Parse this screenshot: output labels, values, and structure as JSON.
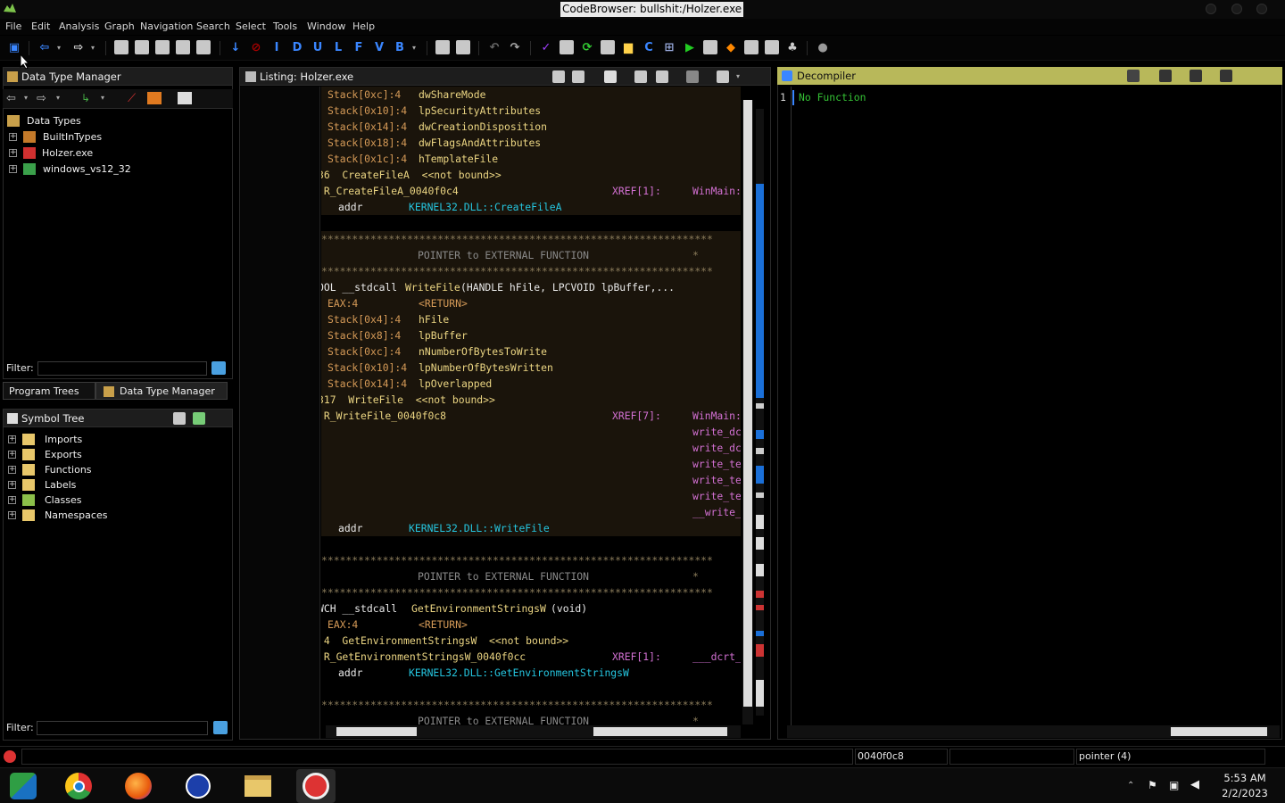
{
  "window": {
    "title": "CodeBrowser: bullshit:/Holzer.exe"
  },
  "menu": [
    "File",
    "Edit",
    "Analysis",
    "Graph",
    "Navigation",
    "Search",
    "Select",
    "Tools",
    "Window",
    "Help"
  ],
  "toolbar": {
    "letters": [
      "I",
      "D",
      "U",
      "L",
      "F",
      "V",
      "B"
    ]
  },
  "data_type_manager": {
    "title": "Data Type Manager",
    "root": "Data Types",
    "items": [
      "BuiltInTypes",
      "Holzer.exe",
      "windows_vs12_32"
    ],
    "filter_label": "Filter:"
  },
  "left_tabs": {
    "program_trees": "Program Trees",
    "data_type_manager": "Data Type Manager"
  },
  "symbol_tree": {
    "title": "Symbol Tree",
    "items": [
      "Imports",
      "Exports",
      "Functions",
      "Labels",
      "Classes",
      "Namespaces"
    ],
    "filter_label": "Filter:"
  },
  "listing": {
    "title": "Listing:  Holzer.exe",
    "lines": [
      {
        "a": "Stack[0xc]:4",
        "b": "dwShareMode"
      },
      {
        "a": "Stack[0x10]:4",
        "b": "lpSecurityAttributes"
      },
      {
        "a": "Stack[0x14]:4",
        "b": "dwCreationDisposition"
      },
      {
        "a": "Stack[0x18]:4",
        "b": "dwFlagsAndAttributes"
      },
      {
        "a": "Stack[0x1c]:4",
        "b": "hTemplateFile"
      },
      {
        "a": "36  CreateFileA  <<not bound>>"
      },
      {
        "a": "'R_CreateFileA_0040f0c4",
        "x": "XREF[1]:",
        "r": "WinMain:"
      },
      {
        "a": "addr",
        "b": "KERNEL32.DLL::CreateFileA"
      },
      {
        "a": "****************************************************************"
      },
      {
        "a": "POINTER to EXTERNAL FUNCTION",
        "b": "*"
      },
      {
        "a": "****************************************************************"
      },
      {
        "a": "OOL __stdcall",
        "b": "WriteFile",
        "c": "(HANDLE hFile, LPCVOID lpBuffer,..."
      },
      {
        "a": "EAX:4",
        "b": "<RETURN>"
      },
      {
        "a": "Stack[0x4]:4",
        "b": "hFile"
      },
      {
        "a": "Stack[0x8]:4",
        "b": "lpBuffer"
      },
      {
        "a": "Stack[0xc]:4",
        "b": "nNumberOfBytesToWrite"
      },
      {
        "a": "Stack[0x10]:4",
        "b": "lpNumberOfBytesWritten"
      },
      {
        "a": "Stack[0x14]:4",
        "b": "lpOverlapped"
      },
      {
        "a": "317  WriteFile  <<not bound>>"
      },
      {
        "a": "'R_WriteFile_0040f0c8",
        "x": "XREF[7]:",
        "r": "WinMain:"
      },
      {
        "r": "write_dc"
      },
      {
        "r": "write_dc"
      },
      {
        "r": "write_te"
      },
      {
        "r": "write_te"
      },
      {
        "r": "write_te"
      },
      {
        "r": "__write_"
      },
      {
        "a": "addr",
        "b": "KERNEL32.DLL::WriteFile"
      },
      {
        "a": "****************************************************************"
      },
      {
        "a": "POINTER to EXTERNAL FUNCTION",
        "b": "*"
      },
      {
        "a": "****************************************************************"
      },
      {
        "a": "WCH __stdcall",
        "b": "GetEnvironmentStringsW",
        "c": "(void)"
      },
      {
        "a": "EAX:4",
        "b": "<RETURN>"
      },
      {
        "a": "'4  GetEnvironmentStringsW  <<not bound>>"
      },
      {
        "a": "'R_GetEnvironmentStringsW_0040f0cc",
        "x": "XREF[1]:",
        "r": "___dcrt_"
      },
      {
        "a": "addr",
        "b": "KERNEL32.DLL::GetEnvironmentStringsW"
      },
      {
        "a": "****************************************************************"
      },
      {
        "a": "POINTER to EXTERNAL FUNCTION",
        "b": "*"
      }
    ]
  },
  "decompiler": {
    "title": "Decompiler",
    "line_number": "1",
    "text": "No Function"
  },
  "status": {
    "address": "0040f0c8",
    "type": "pointer (4)"
  },
  "clock": {
    "time": "5:53 AM",
    "date": "2/2/2023"
  },
  "colors": {
    "accent_blue": "#3a86ff",
    "decompiler_header": "#b8b85a",
    "listing_highlight": "#1a140b"
  }
}
